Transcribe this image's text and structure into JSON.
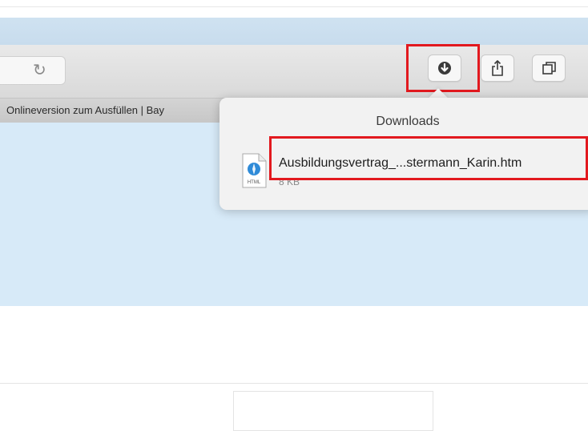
{
  "toolbar": {
    "reload_icon": "reload-icon",
    "download_icon": "download-icon",
    "share_icon": "share-icon",
    "tabs_icon": "tab-overview-icon"
  },
  "tab": {
    "label": "Onlineversion zum Ausfüllen | Bay"
  },
  "downloads": {
    "title": "Downloads",
    "items": [
      {
        "name": "Ausbildungsvertrag_...stermann_Karin.htm",
        "size": "8 KB",
        "icon_label": "HTML"
      }
    ]
  },
  "colors": {
    "highlight": "#e2191f",
    "content_bg": "#d7eaf8"
  }
}
